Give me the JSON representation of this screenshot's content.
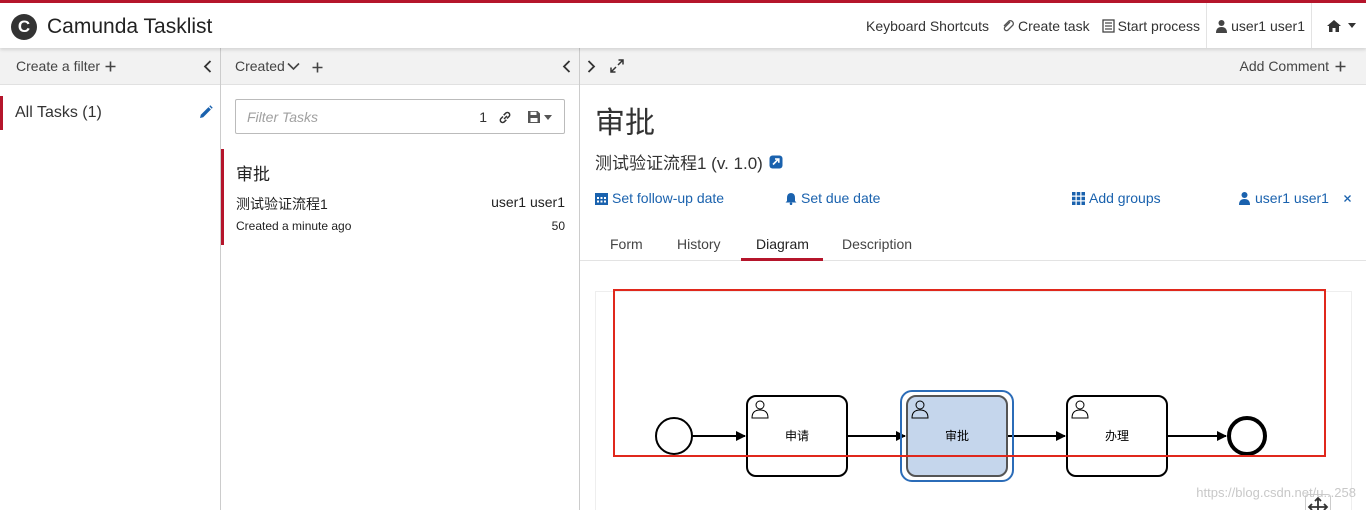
{
  "app": {
    "title": "Camunda Tasklist",
    "logo_letter": "C",
    "accent_color": "#b5152b",
    "link_color": "#1a62ae"
  },
  "header": {
    "nav": {
      "shortcuts": "Keyboard Shortcuts",
      "create_task": "Create task",
      "start_process": "Start process",
      "user": "user1 user1"
    }
  },
  "filters": {
    "create_label": "Create a filter",
    "items": [
      {
        "label": "All Tasks (1)"
      }
    ]
  },
  "task_list": {
    "sort_label": "Created",
    "filter_placeholder": "Filter Tasks",
    "count": "1",
    "tasks": [
      {
        "title": "审批",
        "process": "测试验证流程1",
        "assignee": "user1 user1",
        "created": "Created a minute ago",
        "priority": "50"
      }
    ]
  },
  "detail": {
    "add_comment": "Add Comment",
    "title": "审批",
    "process": "测试验证流程1 (v. 1.0)",
    "actions": {
      "follow_up": "Set follow-up date",
      "due_date": "Set due date",
      "groups": "Add groups",
      "assignee": "user1 user1"
    },
    "tabs": [
      "Form",
      "History",
      "Diagram",
      "Description"
    ],
    "active_tab": "Diagram",
    "diagram": {
      "tasks": [
        "申请",
        "审批",
        "办理"
      ],
      "active_task": "审批",
      "active_fill": "#c5d6ec",
      "active_border": "#2b6cb8"
    }
  },
  "watermark": "https://blog.csdn.net/u...258"
}
